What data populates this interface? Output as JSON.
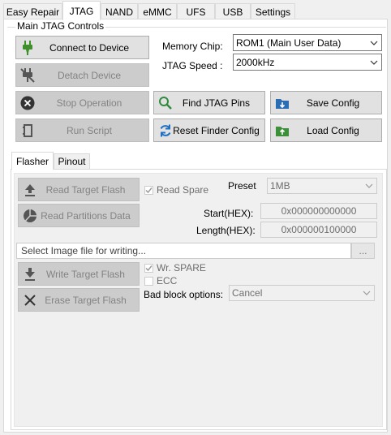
{
  "top_tabs": [
    "Easy Repair",
    "JTAG",
    "NAND",
    "eMMC",
    "UFS",
    "USB",
    "Settings"
  ],
  "active_top_tab": "JTAG",
  "main_group": {
    "title": "Main JTAG Controls",
    "buttons": {
      "connect": "Connect to Device",
      "detach": "Detach Device",
      "stop": "Stop Operation",
      "run_script": "Run Script",
      "find_pins": "Find JTAG Pins",
      "reset_finder": "Reset Finder Config",
      "save_config": "Save Config",
      "load_config": "Load Config"
    },
    "memory_chip_label": "Memory Chip:",
    "memory_chip_value": "ROM1 (Main User Data)",
    "jtag_speed_label": "JTAG Speed :",
    "jtag_speed_value": "2000kHz"
  },
  "sub_tabs": [
    "Flasher",
    "Pinout"
  ],
  "active_sub_tab": "Flasher",
  "flasher": {
    "read_target_flash": "Read Target Flash",
    "read_partitions": "Read Partitions Data",
    "read_spare_label": "Read Spare",
    "read_spare_checked": true,
    "preset_label": "Preset",
    "preset_value": "1MB",
    "start_label": "Start(HEX):",
    "start_value": "0x000000000000",
    "length_label": "Length(HEX):",
    "length_value": "0x000000100000",
    "image_placeholder": "Select Image file for writing...",
    "browse_label": "...",
    "write_target_flash": "Write Target Flash",
    "erase_target_flash": "Erase Target Flash",
    "wr_spare_label": "Wr. SPARE",
    "wr_spare_checked": true,
    "ecc_label": "ECC",
    "ecc_checked": false,
    "bad_block_label": "Bad block options:",
    "bad_block_value": "Cancel"
  },
  "colors": {
    "connect_plug": "#3f8f2a",
    "find_icon": "#2e8b3d",
    "reset_icon": "#1f6fc2",
    "save_icon": "#2a6db5",
    "load_icon": "#3d8f3a"
  }
}
